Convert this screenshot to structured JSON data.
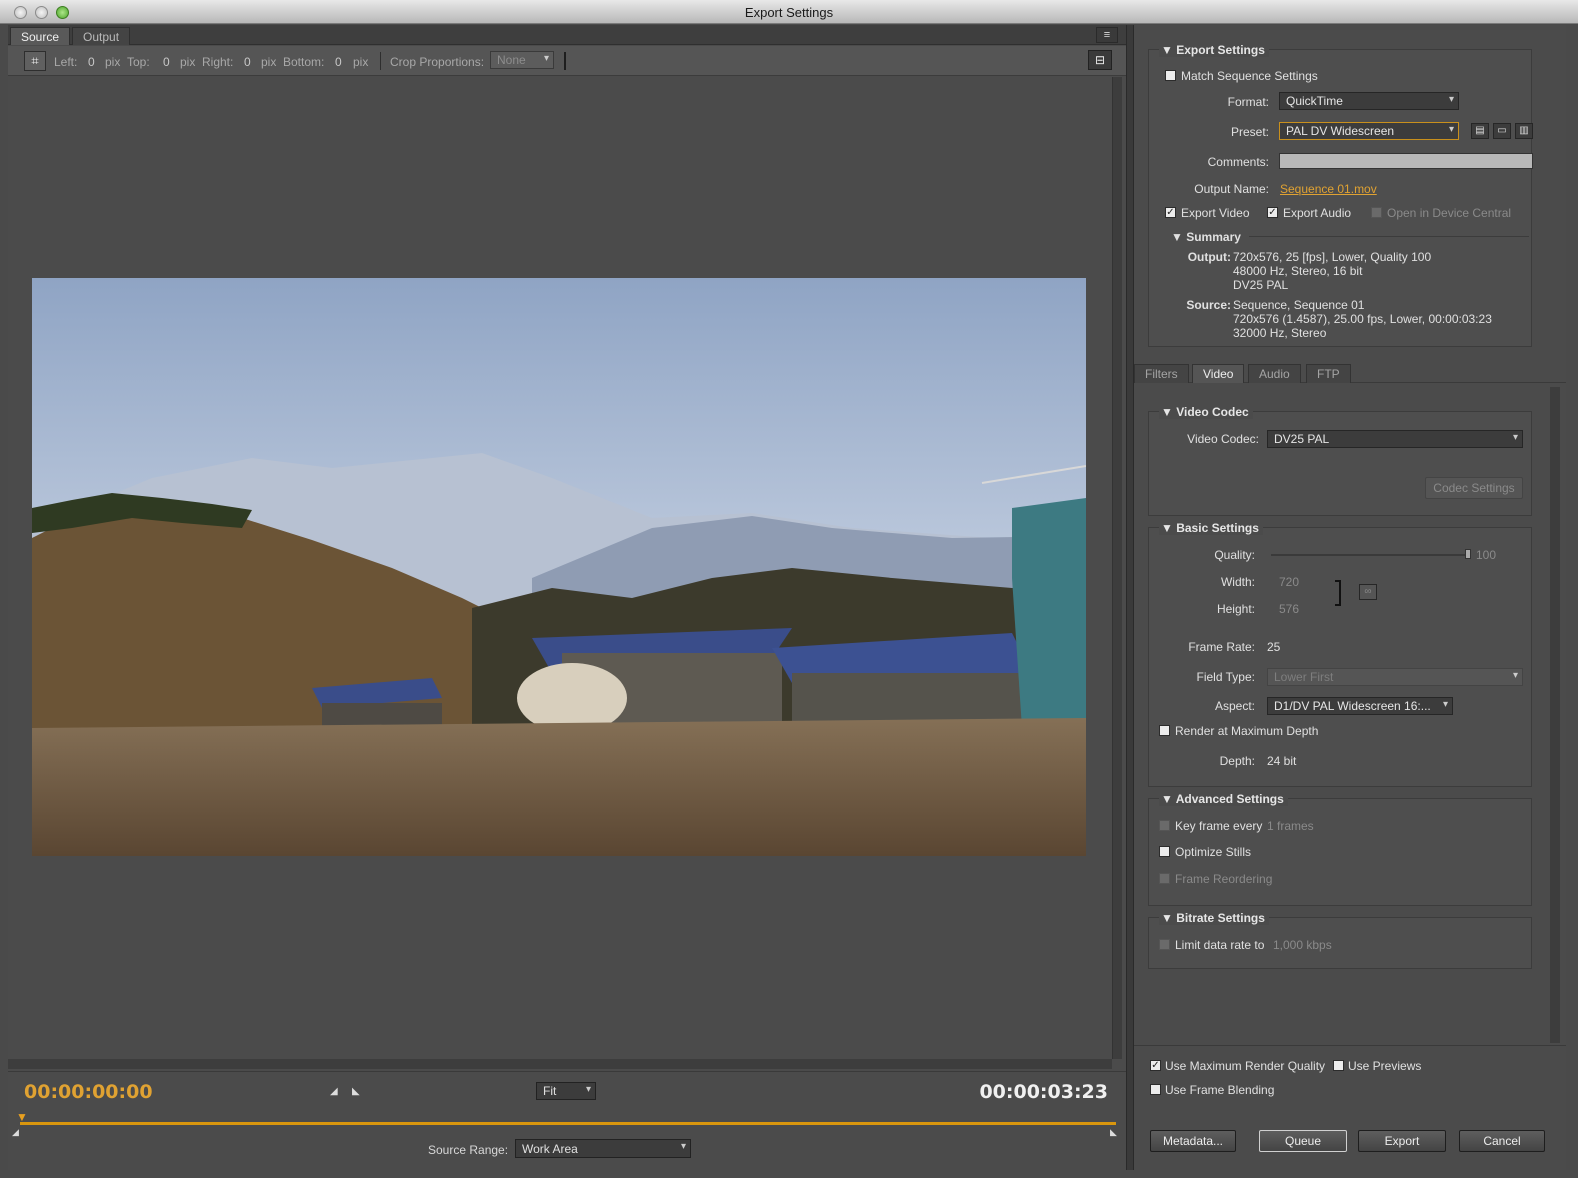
{
  "window": {
    "title": "Export Settings"
  },
  "left": {
    "tabs": [
      {
        "label": "Source"
      },
      {
        "label": "Output"
      }
    ],
    "crop": {
      "left_label": "Left:",
      "left_value": "0",
      "left_unit": "pix",
      "top_label": "Top:",
      "top_value": "0",
      "top_unit": "pix",
      "right_label": "Right:",
      "right_value": "0",
      "right_unit": "pix",
      "bottom_label": "Bottom:",
      "bottom_value": "0",
      "bottom_unit": "pix",
      "proportions_label": "Crop Proportions:",
      "proportions_value": "None"
    },
    "timecode_start": "00:00:00:00",
    "timecode_end": "00:00:03:23",
    "zoom_value": "Fit",
    "source_range_label": "Source Range:",
    "source_range_value": "Work Area"
  },
  "export_settings": {
    "heading": "Export Settings",
    "match_sequence_label": "Match Sequence Settings",
    "match_sequence_checked": false,
    "format_label": "Format:",
    "format_value": "QuickTime",
    "preset_label": "Preset:",
    "preset_value": "PAL DV Widescreen",
    "comments_label": "Comments:",
    "output_name_label": "Output Name:",
    "output_name_value": "Sequence 01.mov",
    "export_video_label": "Export Video",
    "export_video_checked": true,
    "export_audio_label": "Export Audio",
    "export_audio_checked": true,
    "open_device_central_label": "Open in Device Central",
    "open_device_central_checked": false
  },
  "summary": {
    "heading": "Summary",
    "output_label": "Output:",
    "output_lines": [
      "720x576, 25 [fps], Lower, Quality 100",
      "48000 Hz, Stereo, 16 bit",
      "DV25 PAL"
    ],
    "source_label": "Source:",
    "source_lines": [
      "Sequence, Sequence 01",
      "720x576 (1.4587), 25.00 fps, Lower, 00:00:03:23",
      "32000 Hz, Stereo"
    ]
  },
  "settings_tabs": [
    {
      "label": "Filters"
    },
    {
      "label": "Video"
    },
    {
      "label": "Audio"
    },
    {
      "label": "FTP"
    }
  ],
  "video_codec": {
    "heading": "Video Codec",
    "codec_label": "Video Codec:",
    "codec_value": "DV25 PAL",
    "codec_settings_button": "Codec Settings"
  },
  "basic_settings": {
    "heading": "Basic Settings",
    "quality_label": "Quality:",
    "quality_value": "100",
    "quality_level": 100,
    "width_label": "Width:",
    "width_value": "720",
    "height_label": "Height:",
    "height_value": "576",
    "frame_rate_label": "Frame Rate:",
    "frame_rate_value": "25",
    "field_type_label": "Field Type:",
    "field_type_value": "Lower First",
    "aspect_label": "Aspect:",
    "aspect_value": "D1/DV PAL Widescreen 16:...",
    "render_max_depth_label": "Render at Maximum Depth",
    "render_max_depth_checked": false,
    "depth_label": "Depth:",
    "depth_value": "24 bit"
  },
  "advanced_settings": {
    "heading": "Advanced Settings",
    "keyframe_label": "Key frame every",
    "keyframe_value": "1 frames",
    "optimize_stills_label": "Optimize Stills",
    "frame_reordering_label": "Frame Reordering"
  },
  "bitrate_settings": {
    "heading": "Bitrate Settings",
    "limit_label": "Limit data rate to",
    "limit_value": "1,000 kbps"
  },
  "footer": {
    "max_render_quality_label": "Use Maximum Render Quality",
    "max_render_quality_checked": true,
    "use_previews_label": "Use Previews",
    "use_previews_checked": false,
    "frame_blending_label": "Use Frame Blending",
    "frame_blending_checked": false,
    "metadata_button": "Metadata...",
    "queue_button": "Queue",
    "export_button": "Export",
    "cancel_button": "Cancel"
  },
  "colors": {
    "accent": "#e0a232",
    "panel": "#4b4b4b"
  }
}
